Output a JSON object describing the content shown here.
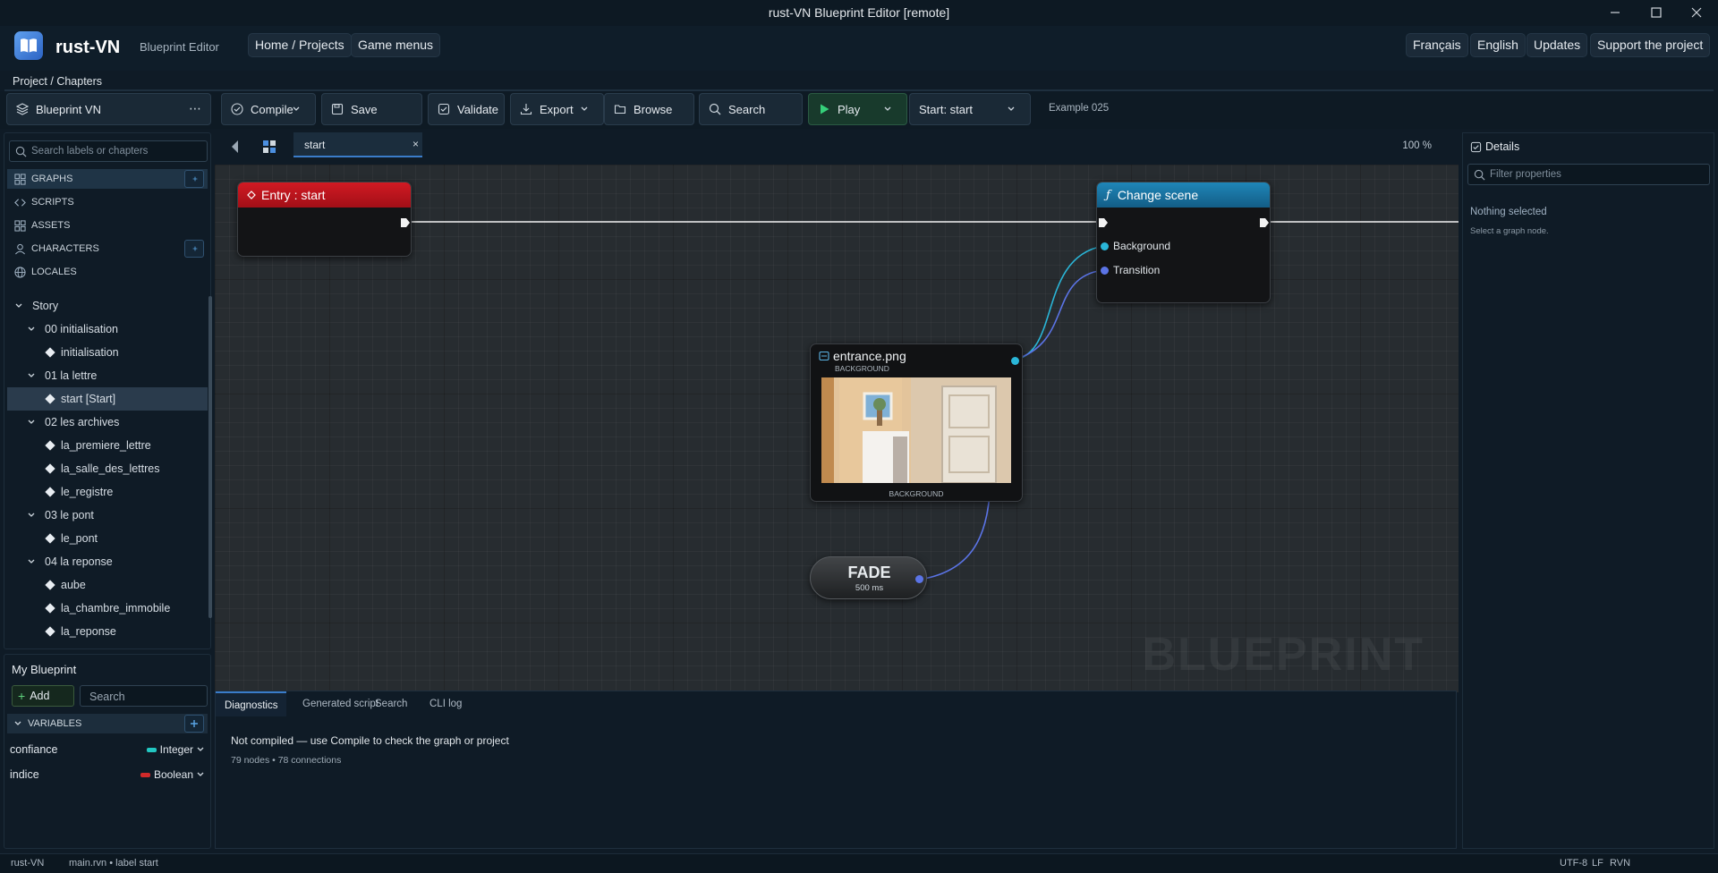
{
  "window": {
    "title": "rust-VN Blueprint Editor [remote]"
  },
  "header": {
    "brand": "rust-VN",
    "subtitle": "Blueprint Editor",
    "nav": [
      "Home / Projects",
      "Game menus"
    ],
    "right": [
      "Français",
      "English",
      "Updates",
      "Support the project"
    ]
  },
  "breadcrumb": "Project / Chapters",
  "toolbar": {
    "project": "Blueprint VN",
    "compile": "Compile",
    "save": "Save",
    "validate": "Validate",
    "export": "Export",
    "browse": "Browse",
    "search": "Search",
    "play": "Play",
    "start_select": "Start: start",
    "example": "Example 025"
  },
  "sidebar": {
    "search_placeholder": "Search labels or chapters",
    "sections": [
      {
        "label": "GRAPHS",
        "icon": "graph-icon",
        "active": true,
        "addable": true
      },
      {
        "label": "SCRIPTS",
        "icon": "code-icon",
        "active": false,
        "addable": false
      },
      {
        "label": "ASSETS",
        "icon": "grid-icon",
        "active": false,
        "addable": false
      },
      {
        "label": "CHARACTERS",
        "icon": "user-icon",
        "active": false,
        "addable": true
      },
      {
        "label": "LOCALES",
        "icon": "globe-icon",
        "active": false,
        "addable": false
      }
    ],
    "tree": [
      {
        "label": "Story",
        "depth": 0,
        "kind": "folder"
      },
      {
        "label": "00 initialisation",
        "depth": 1,
        "kind": "folder"
      },
      {
        "label": "initialisation",
        "depth": 2,
        "kind": "label"
      },
      {
        "label": "01 la lettre",
        "depth": 1,
        "kind": "folder"
      },
      {
        "label": "start [Start]",
        "depth": 2,
        "kind": "label",
        "selected": true
      },
      {
        "label": "02 les archives",
        "depth": 1,
        "kind": "folder"
      },
      {
        "label": "la_premiere_lettre",
        "depth": 2,
        "kind": "label"
      },
      {
        "label": "la_salle_des_lettres",
        "depth": 2,
        "kind": "label"
      },
      {
        "label": "le_registre",
        "depth": 2,
        "kind": "label"
      },
      {
        "label": "03 le pont",
        "depth": 1,
        "kind": "folder"
      },
      {
        "label": "le_pont",
        "depth": 2,
        "kind": "label"
      },
      {
        "label": "04 la reponse",
        "depth": 1,
        "kind": "folder"
      },
      {
        "label": "aube",
        "depth": 2,
        "kind": "label"
      },
      {
        "label": "la_chambre_immobile",
        "depth": 2,
        "kind": "label"
      },
      {
        "label": "la_reponse",
        "depth": 2,
        "kind": "label"
      }
    ]
  },
  "blueprint": {
    "title": "My Blueprint",
    "add": "Add",
    "search_placeholder": "Search",
    "variables_header": "VARIABLES",
    "variables": [
      {
        "name": "confiance",
        "type": "Integer",
        "color": "#22c7c2"
      },
      {
        "name": "indice",
        "type": "Boolean",
        "color": "#d12a2a"
      }
    ]
  },
  "canvas": {
    "tab": "start",
    "zoom": "100 %",
    "watermark": "BLUEPRINT",
    "nodes": {
      "entry": {
        "title": "Entry : start",
        "color": "#b8141c"
      },
      "change_scene": {
        "title": "Change scene",
        "color": "#1b76a6",
        "pins": [
          "Background",
          "Transition"
        ]
      },
      "image": {
        "title": "entrance.png",
        "subtitle": "BACKGROUND",
        "footer": "BACKGROUND"
      },
      "fade": {
        "title": "FADE",
        "subtitle": "500 ms"
      }
    }
  },
  "bottom": {
    "tabs": [
      "Diagnostics",
      "Generated script",
      "Search",
      "CLI log"
    ],
    "message": "Not compiled — use Compile to check the graph or project",
    "stats": "79 nodes • 78 connections"
  },
  "details": {
    "title": "Details",
    "filter_placeholder": "Filter properties",
    "empty_title": "Nothing selected",
    "empty_hint": "Select a graph node."
  },
  "status": {
    "app": "rust-VN",
    "file": "main.rvn • label start",
    "encoding": "UTF-8",
    "eol": "LF",
    "lang": "RVN"
  }
}
